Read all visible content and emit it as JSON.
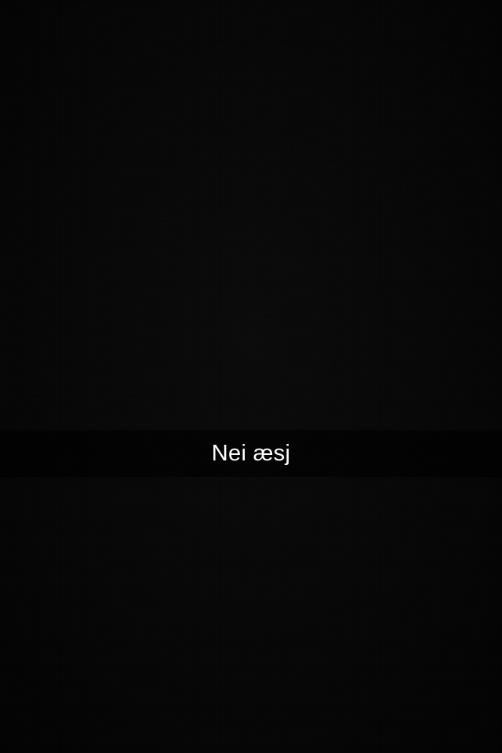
{
  "caption": {
    "text": "Nei æsj"
  },
  "colors": {
    "background": "#050505",
    "caption_text": "#ffffff"
  }
}
